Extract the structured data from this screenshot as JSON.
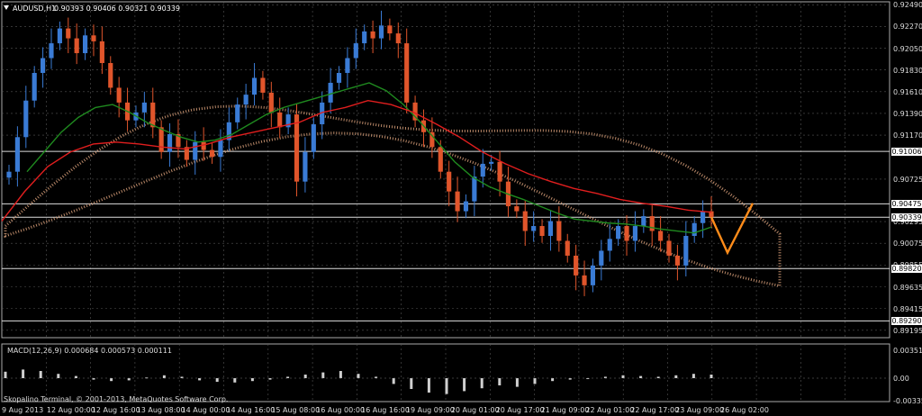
{
  "header": {
    "symbol": "AUDUSD,H1",
    "ohlc": "0.90393 0.90406 0.90321 0.90339"
  },
  "price_axis": [
    {
      "label": "0.92490",
      "v": 0.9249
    },
    {
      "label": "0.92270",
      "v": 0.9227
    },
    {
      "label": "0.92050",
      "v": 0.9205
    },
    {
      "label": "0.91830",
      "v": 0.9183
    },
    {
      "label": "0.91610",
      "v": 0.9161
    },
    {
      "label": "0.91390",
      "v": 0.9139
    },
    {
      "label": "0.91170",
      "v": 0.9117
    },
    {
      "label": "0.90725",
      "v": 0.90725
    },
    {
      "label": "0.90295",
      "v": 0.90295
    },
    {
      "label": "0.90075",
      "v": 0.90075
    },
    {
      "label": "0.89855",
      "v": 0.89855
    },
    {
      "label": "0.89635",
      "v": 0.89635
    },
    {
      "label": "0.89415",
      "v": 0.89415
    },
    {
      "label": "0.89195",
      "v": 0.89195
    }
  ],
  "level_tags": [
    {
      "label": "0.91006",
      "v": 0.91006
    },
    {
      "label": "0.90475",
      "v": 0.90475
    },
    {
      "label": "0.90339",
      "v": 0.90339
    },
    {
      "label": "0.89820",
      "v": 0.8982
    },
    {
      "label": "0.89290",
      "v": 0.8929
    }
  ],
  "time_axis": [
    "9 Aug 2013",
    "12 Aug 00:00",
    "12 Aug 16:00",
    "13 Aug 08:00",
    "14 Aug 00:00",
    "14 Aug 16:00",
    "15 Aug 08:00",
    "16 Aug 00:00",
    "16 Aug 16:00",
    "19 Aug 09:00",
    "20 Aug 01:00",
    "20 Aug 17:00",
    "21 Aug 09:00",
    "22 Aug 01:00",
    "22 Aug 17:00",
    "23 Aug 09:00",
    "26 Aug 02:00"
  ],
  "indicator": {
    "label": "MACD(12,26,9) 0.000684 0.000573 0.000111",
    "axis": [
      {
        "label": "0.003516",
        "v": 0.003516
      },
      {
        "label": "0.00",
        "v": 0
      },
      {
        "label": "-0.003352",
        "v": -0.003352
      }
    ]
  },
  "copyright": "Skopalino Terminal, © 2001-2013, MetaQuotes Software Corp.",
  "chart_data": {
    "type": "candlestick",
    "symbol": "AUDUSD",
    "timeframe": "H1",
    "ylim": [
      0.8912,
      0.9252
    ],
    "grid": true,
    "colors": {
      "bull": "#3a7bd5",
      "bear": "#e0552b",
      "ma_fast": "#1f8a1f",
      "ma_slow": "#e01e1e",
      "cloud": "#d9a07a",
      "forecast": "#ff8c1a"
    },
    "close": [
      0.908,
      0.9115,
      0.9152,
      0.918,
      0.9195,
      0.921,
      0.9225,
      0.9215,
      0.92,
      0.9218,
      0.9212,
      0.919,
      0.9165,
      0.915,
      0.9132,
      0.914,
      0.915,
      0.9125,
      0.91,
      0.9118,
      0.9105,
      0.9092,
      0.911,
      0.9102,
      0.9095,
      0.9112,
      0.913,
      0.9148,
      0.9158,
      0.9175,
      0.916,
      0.914,
      0.9125,
      0.9138,
      0.907,
      0.91,
      0.9128,
      0.915,
      0.917,
      0.918,
      0.9195,
      0.921,
      0.9222,
      0.9215,
      0.9228,
      0.922,
      0.921,
      0.915,
      0.9132,
      0.912,
      0.9105,
      0.908,
      0.906,
      0.904,
      0.905,
      0.9075,
      0.9088,
      0.909,
      0.907,
      0.9045,
      0.904,
      0.902,
      0.9025,
      0.9015,
      0.903,
      0.901,
      0.8995,
      0.8975,
      0.8965,
      0.8985,
      0.9,
      0.9012,
      0.9025,
      0.901,
      0.9025,
      0.9035,
      0.902,
      0.901,
      0.8995,
      0.8985,
      0.9015,
      0.9028,
      0.904,
      0.9034
    ],
    "ma_fast": [
      0.908,
      0.91,
      0.912,
      0.9135,
      0.9145,
      0.9148,
      0.914,
      0.913,
      0.9122,
      0.9115,
      0.911,
      0.9112,
      0.9118,
      0.9128,
      0.9138,
      0.9145,
      0.915,
      0.9155,
      0.916,
      0.9165,
      0.917,
      0.9162,
      0.9148,
      0.913,
      0.911,
      0.909,
      0.9075,
      0.9065,
      0.9058,
      0.9052,
      0.9045,
      0.9038,
      0.9032,
      0.903,
      0.9028,
      0.9027,
      0.9025,
      0.9022,
      0.902,
      0.9018,
      0.9024
    ],
    "ma_slow": [
      0.903,
      0.906,
      0.9085,
      0.91,
      0.9108,
      0.911,
      0.9108,
      0.9105,
      0.9103,
      0.9108,
      0.9115,
      0.912,
      0.9125,
      0.913,
      0.914,
      0.9145,
      0.9152,
      0.9148,
      0.914,
      0.9128,
      0.9115,
      0.91,
      0.9088,
      0.9078,
      0.907,
      0.9063,
      0.9058,
      0.9052,
      0.9048,
      0.9045,
      0.9041,
      0.9039
    ],
    "macd_hist": [
      0.0009,
      0.0012,
      0.001,
      0.0006,
      0.0003,
      -0.0002,
      -0.0004,
      -0.0003,
      0.0001,
      0.0004,
      0.0002,
      -0.0003,
      -0.0005,
      -0.0006,
      -0.0004,
      -0.0002,
      0.0002,
      0.0005,
      0.0008,
      0.001,
      0.0006,
      0.0002,
      -0.0008,
      -0.0015,
      -0.002,
      -0.0022,
      -0.0018,
      -0.0014,
      -0.001,
      -0.0012,
      -0.0008,
      -0.0004,
      -0.0002,
      0.0,
      0.0002,
      0.0004,
      0.0003,
      0.0002,
      0.0004,
      0.0006,
      0.0005
    ]
  }
}
